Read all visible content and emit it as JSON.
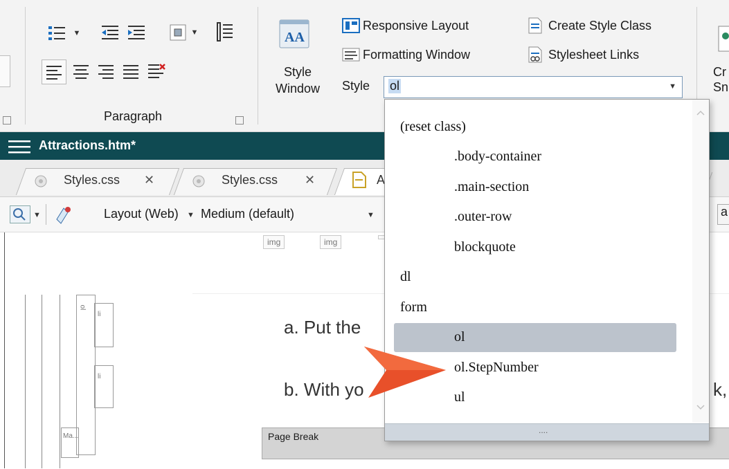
{
  "ribbon": {
    "paragraph_group_label": "Paragraph",
    "style_window_label_line1": "Style",
    "style_window_label_line2": "Window",
    "responsive_layout": "Responsive Layout",
    "formatting_window": "Formatting Window",
    "create_style_class": "Create Style Class",
    "stylesheet_links": "Stylesheet Links",
    "style_label": "Style",
    "style_value": "ol",
    "create_snippet_partial_line1": "Cr",
    "create_snippet_partial_line2": "Sni"
  },
  "document": {
    "title": "Attractions.htm*"
  },
  "tabs": [
    {
      "label": "Styles.css"
    },
    {
      "label": "Styles.css"
    },
    {
      "label": "A"
    }
  ],
  "toolbar": {
    "layout_mode": "Layout (Web)",
    "medium": "Medium (default)",
    "right_partial": "a"
  },
  "content": {
    "img_tags": [
      "img",
      "img"
    ],
    "side_tags": [
      "ol",
      "li",
      "li",
      "Ma..."
    ],
    "step_a": "a.  Put the",
    "step_b": "b.  With yo",
    "step_b_tail": "k,",
    "page_break": "Page Break"
  },
  "style_dropdown": {
    "items": [
      {
        "label": "(reset class)",
        "indent": 0
      },
      {
        "label": ".body-container",
        "indent": 1
      },
      {
        "label": ".main-section",
        "indent": 1
      },
      {
        "label": ".outer-row",
        "indent": 1
      },
      {
        "label": "blockquote",
        "indent": 1
      },
      {
        "label": "dl",
        "indent": 0
      },
      {
        "label": "form",
        "indent": 0
      },
      {
        "label": "ol",
        "indent": 1,
        "selected": true
      },
      {
        "label": "ol.StepNumber",
        "indent": 1
      },
      {
        "label": "ul",
        "indent": 1
      }
    ],
    "footer_grip": "...."
  },
  "colors": {
    "titlebar": "#0f4a52",
    "selection": "#bcc3cc",
    "callout_arrow": "#e8502a"
  }
}
